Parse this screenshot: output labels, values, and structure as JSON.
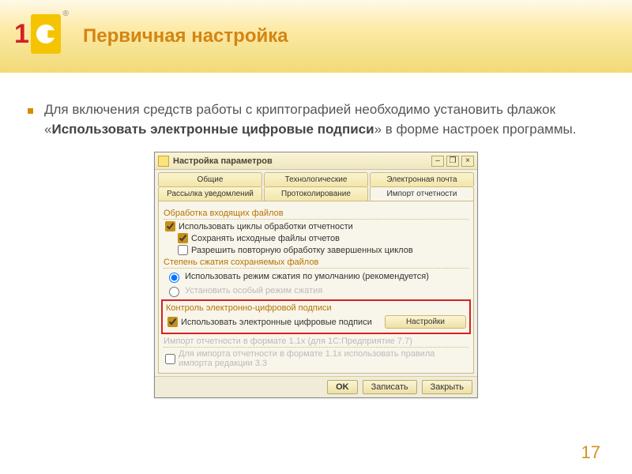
{
  "header": {
    "title": "Первичная настройка"
  },
  "bullet": {
    "pre": "Для включения средств работы с криптографией необходимо установить флажок «",
    "bold": "Использовать электронные цифровые подписи",
    "post": "» в форме настроек программы."
  },
  "window": {
    "title": "Настройка параметров",
    "tabs_row1": [
      "Общие",
      "Технологические",
      "Электронная почта"
    ],
    "tabs_row2": [
      "Рассылка уведомлений",
      "Протоколирование",
      "Импорт отчетности"
    ],
    "active_tab": "Импорт отчетности",
    "group1": {
      "title": "Обработка входящих файлов",
      "chk1": "Использовать циклы обработки отчетности",
      "chk2": "Сохранять исходные файлы отчетов",
      "chk3": "Разрешить повторную обработку завершенных циклов"
    },
    "group2": {
      "title": "Степень сжатия сохраняемых файлов",
      "radio1": "Использовать режим сжатия по умолчанию (рекомендуется)",
      "radio2": "Установить особый режим сжатия"
    },
    "group3": {
      "title": "Контроль электронно-цифровой подписи",
      "chk": "Использовать электронные цифровые подписи",
      "btn": "Настройки"
    },
    "group4": {
      "title": "Импорт отчетности в формате 1.1х (для 1С:Предприятие 7.7)",
      "chk": "Для импорта отчетности в формате 1.1х использовать правила импорта редакции 3.3"
    },
    "buttons": {
      "ok": "OK",
      "save": "Записать",
      "close": "Закрыть"
    },
    "win_btns": {
      "min": "–",
      "max": "❐",
      "close": "×"
    }
  },
  "page_number": "17"
}
